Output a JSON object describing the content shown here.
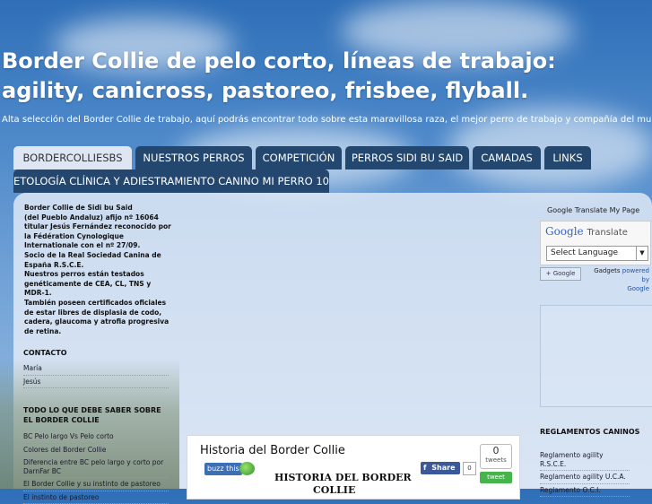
{
  "header": {
    "title": "Border Collie de pelo corto, líneas de trabajo: agility, canicross, pastoreo, frisbee, flyball.",
    "description": "Alta selección del Border Collie de trabajo, aquí podrás encontrar todo sobre esta maravillosa raza, el mejor perro de trabajo y compañía del mundo."
  },
  "tabs": [
    {
      "label": "BORDERCOLLIESBS"
    },
    {
      "label": "NUESTROS PERROS"
    },
    {
      "label": "COMPETICIÓN"
    },
    {
      "label": "PERROS SIDI BU SAID"
    },
    {
      "label": "CAMADAS"
    },
    {
      "label": "LINKS"
    },
    {
      "label": "ETOLOGÍA CLÍNICA Y ADIESTRAMIENTO CANINO MI PERRO 10"
    }
  ],
  "sidebar": {
    "intro": "Border Collie de Sidi bu Said\n(del Pueblo Andaluz) afijo nº 16064 titular Jesús Fernández reconocido por la Fédération Cynologique Internationale con el nº 27/09.\nSocio de la Real Sociedad Canina de España R.S.C.E.\nNuestros perros están testados genéticamente de CEA, CL, TNS y MDR-1.\nTambién poseen certificados oficiales de estar libres de displasia de codo, cadera, glaucoma y atrofia progresiva de retina.",
    "contact": {
      "heading": "CONTACTO",
      "items": [
        "María",
        "Jesús"
      ]
    },
    "learn": {
      "heading": "TODO LO QUE DEBE SABER SOBRE EL BORDER COLLIE",
      "items": [
        "BC Pelo largo Vs Pelo corto",
        "Colores del Border Collie",
        "Diferencia entre BC pelo largo y corto por DarnFar BC",
        "El Border Collie y su instinto de pastoreo",
        "El instinto de pastoreo"
      ]
    }
  },
  "post": {
    "title": "Historia del Border Collie",
    "buzz_label": "buzz this",
    "share_label": "Share",
    "share_count": "0",
    "tweet_count": "0",
    "tweet_label": "tweets",
    "tweet_button": "tweet",
    "doc_heading": "HISTORIA DEL BORDER",
    "doc_heading2": "COLLIE"
  },
  "translate": {
    "label": "Google Translate My Page",
    "logo_google": "Google",
    "logo_translate": "Translate",
    "select_label": "Select Language",
    "add_label": "+ Google",
    "gadgets": "Gadgets",
    "powered_by": "powered by",
    "google": "Google"
  },
  "reglamentos": {
    "heading": "REGLAMENTOS CANINOS",
    "items": [
      "Reglamento agility R.S.C.E.",
      "Reglamento agility U.C.A.",
      "Reglamento O.C.I."
    ]
  },
  "colors": {
    "sky_top": "#2f6fb8",
    "tab_bg": "#24476f",
    "tab_active_bg": "#dde6f2",
    "facebook": "#3b5998",
    "tweet_green": "#45b54b"
  }
}
